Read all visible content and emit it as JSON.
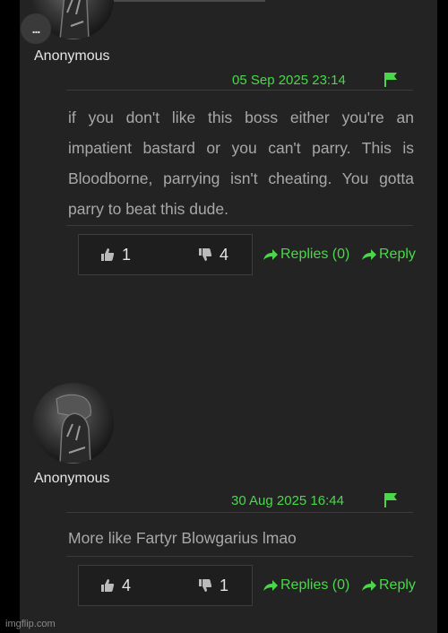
{
  "comments": [
    {
      "author": "Anonymous",
      "date": "05 Sep 2025 23:14",
      "text": "if you don't like this boss either you're an impatient bastard or you can't parry. This is Bloodborne, parrying isn't cheating. You gotta parry to beat this dude.",
      "likes": "1",
      "dislikes": "4",
      "replies_label": "Replies (0)",
      "reply_label": "Reply"
    },
    {
      "author": "Anonymous",
      "date": "30 Aug 2025 16:44",
      "text": "More like Fartyr Blowgarius lmao",
      "likes": "4",
      "dislikes": "1",
      "replies_label": "Replies (0)",
      "reply_label": "Reply"
    }
  ],
  "menu_label": "...",
  "watermark": "imgflip.com",
  "colors": {
    "accent": "#4ad84a",
    "panel": "#232323",
    "text": "#a8a8a8"
  },
  "icons": [
    "more-options-icon",
    "flag-icon",
    "thumbs-up-icon",
    "thumbs-down-icon",
    "reply-arrow-icon"
  ]
}
